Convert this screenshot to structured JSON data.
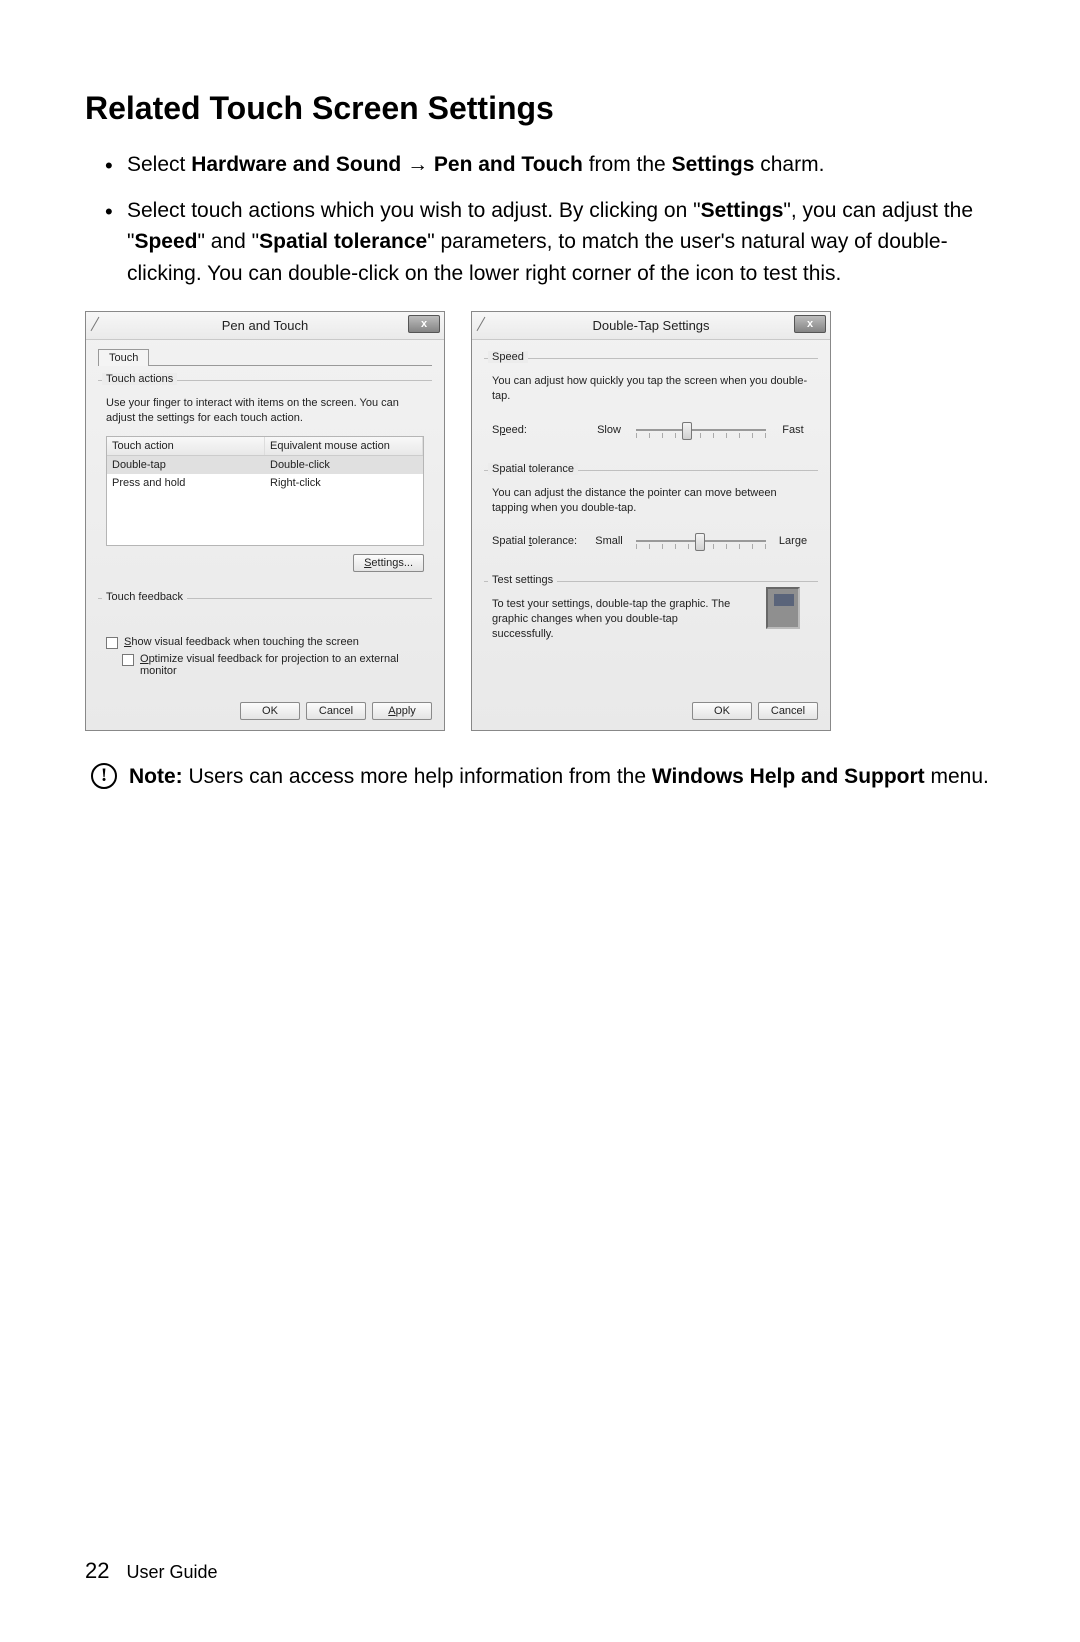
{
  "heading": "Related Touch Screen Settings",
  "bullet1": {
    "pre": "Select ",
    "hw": "Hardware and Sound",
    "arrow": " → ",
    "pen": "Pen and Touch",
    "mid": " from the ",
    "settings": "Settings",
    "post": " charm."
  },
  "bullet2": {
    "t1": "Select touch actions which you wish to adjust. By clicking on \"",
    "b1": "Settings",
    "t2": "\", you can adjust the \"",
    "b2": "Speed",
    "t3": "\" and \"",
    "b3": "Spatial tolerance",
    "t4": "\" parameters, to match the user's natural way of double-clicking. You can double-click on the lower right corner of the icon to test this."
  },
  "dlg1": {
    "title": "Pen and Touch",
    "close": "x",
    "tab": "Touch",
    "grp1": "Touch actions",
    "grp1desc": "Use your finger to interact with items on the screen. You can adjust the settings for each touch action.",
    "col1": "Touch action",
    "col2": "Equivalent mouse action",
    "r1c1": "Double-tap",
    "r1c2": "Double-click",
    "r2c1": "Press and hold",
    "r2c2": "Right-click",
    "settingsBtn": "Settings...",
    "grp2": "Touch feedback",
    "chk1": "Show visual feedback when touching the screen",
    "chk2": "Optimize visual feedback for projection to an external monitor",
    "ok": "OK",
    "cancel": "Cancel",
    "apply": "Apply"
  },
  "dlg2": {
    "title": "Double-Tap Settings",
    "close": "x",
    "grp1": "Speed",
    "grp1desc": "You can adjust how quickly you tap the screen when you double-tap.",
    "speedLabel": "Speed:",
    "slow": "Slow",
    "fast": "Fast",
    "grp2": "Spatial tolerance",
    "grp2desc": "You can adjust the distance the pointer can move between tapping when you double-tap.",
    "stLabel": "Spatial tolerance:",
    "small": "Small",
    "large": "Large",
    "grp3": "Test settings",
    "grp3desc": "To test your settings, double-tap the graphic. The graphic changes when you double-tap successfully.",
    "ok": "OK",
    "cancel": "Cancel"
  },
  "note": {
    "lead": "Note:",
    "t1": " Users can access more help information from the ",
    "b1": "Windows Help and Support",
    "t2": " menu."
  },
  "footer": {
    "page": "22",
    "label": "User Guide"
  }
}
